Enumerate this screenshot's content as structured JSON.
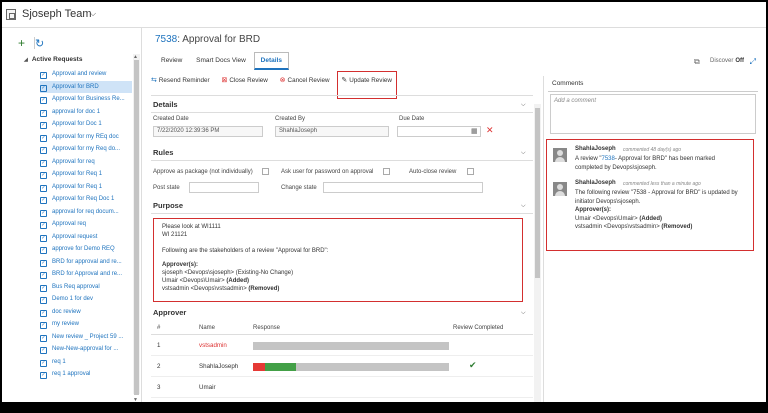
{
  "header": {
    "team_name": "Sjoseph Team"
  },
  "sidebar": {
    "section_label": "Active Requests",
    "items": [
      "Approval and review",
      "Approval for BRD",
      "Approval for Business Re...",
      "approval for doc 1",
      "Approval for Doc 1",
      "Approval for my REq doc",
      "Approval for my Req do...",
      "Approval for req",
      "Approval for Req 1",
      "Approval for Req 1",
      "Approval for Req Doc 1",
      "approval for req docum...",
      "Approval req",
      "Approval request",
      "approve for Demo REQ",
      "BRD for approval and re...",
      "BRD for Approval and re...",
      "Bus Req approval",
      "Demo 1 for dev",
      "doc review",
      "my review",
      "New review _ Project 59 ...",
      "New-New-approval for ...",
      "req 1",
      "req 1 approval"
    ],
    "selected_index": 1
  },
  "main": {
    "title_id": "7538",
    "title_text": ": Approval for BRD",
    "tabs": [
      "Review",
      "Smart Docs View",
      "Details"
    ],
    "active_tab": "Details",
    "discover_label": "Discover",
    "discover_state": "Off",
    "toolbar": {
      "resend": "Resend Reminder",
      "close": "Close Review",
      "cancel": "Cancel Review",
      "update": "Update Review"
    },
    "details": {
      "heading": "Details",
      "created_date_label": "Created Date",
      "created_date_value": "7/22/2020 12:39:36 PM",
      "created_by_label": "Created By",
      "created_by_value": "ShahlaJoseph",
      "due_date_label": "Due Date"
    },
    "rules": {
      "heading": "Rules",
      "approve_pkg": "Approve as package (not individually)",
      "ask_password": "Ask user for password on approval",
      "auto_close": "Auto-close review",
      "post_state": "Post state",
      "change_state": "Change state"
    },
    "purpose": {
      "heading": "Purpose",
      "line1": "Please look at WI1111",
      "line2": "WI 21121",
      "line3": "Following are the stakeholders of a review \"Approval for BRD\":",
      "approvers_label": "Approver(s):",
      "a1": "sjoseph <Devops\\sjoseph> (Existing-No Change)",
      "a2_name": "Umair <Devops\\Umair>",
      "a2_tag": "(Added)",
      "a3_name": "vstsadmin <Devops\\vstsadmin>",
      "a3_tag": "(Removed)"
    },
    "approver": {
      "heading": "Approver",
      "col_num": "#",
      "col_name": "Name",
      "col_response": "Response",
      "col_completed": "Review Completed",
      "rows": [
        {
          "num": "1",
          "name": "vstsadmin",
          "removed": true,
          "red": 0,
          "green": 0,
          "done": false
        },
        {
          "num": "2",
          "name": "ShahlaJoseph",
          "removed": false,
          "red": 0.06,
          "green": 0.16,
          "done": true
        },
        {
          "num": "3",
          "name": "Umair",
          "removed": false,
          "red": 0,
          "green": 0,
          "done": false
        }
      ]
    }
  },
  "comments": {
    "heading": "Comments",
    "placeholder": "Add a comment",
    "c1_author": "ShahlaJoseph",
    "c1_meta": "commented 48 day(s) ago",
    "c1_pre": "A review \"",
    "c1_link": "7538",
    "c1_post": "- Approval for BRD\" has been marked completed by Devops\\sjoseph.",
    "c2_author": "ShahlaJoseph",
    "c2_meta": "commented less than a minute ago",
    "c2_text": "The following review \"7538 - Approval for BRD\" is updated by initiator Devops\\sjoseph.",
    "c2_approvers": "Approver(s):",
    "c2_a1_name": "Umair <Devops\\Umair>",
    "c2_a1_tag": "(Added)",
    "c2_a2_name": "vstsadmin <Devops\\vstsadmin>",
    "c2_a2_tag": "(Removed)"
  }
}
